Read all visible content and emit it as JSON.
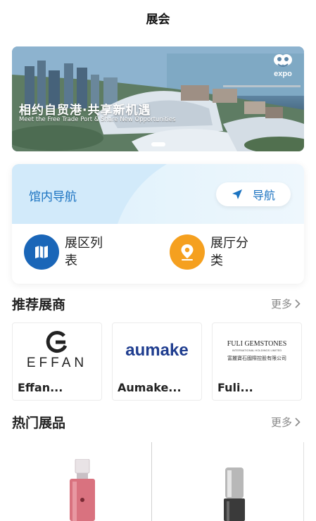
{
  "header": {
    "title": "展会"
  },
  "banner": {
    "headline": "相约自贸港·共享新机遇",
    "subline": "Meet the Free Trade Port & Share New Opportunities",
    "logo_text": "expo"
  },
  "navigation_card": {
    "title": "馆内导航",
    "button_label": "导航",
    "items": [
      {
        "label": "展区列表",
        "icon": "map-icon",
        "color": "#1a66b8"
      },
      {
        "label": "展厅分类",
        "icon": "location-pin-icon",
        "color": "#f5a01f"
      }
    ]
  },
  "recommended_exhibitors": {
    "title": "推荐展商",
    "more_label": "更多",
    "items": [
      {
        "logo_text": "EFFAN",
        "name": "Effan..."
      },
      {
        "logo_text": "aumake",
        "name": "Aumake..."
      },
      {
        "logo_text": "FULI GEMSTONES",
        "logo_sub": "INTERNATIONAL HOLDINGS LIMITED",
        "logo_cn": "富麗寶石國際控股有限公司",
        "name": "Fuli..."
      }
    ]
  },
  "hot_products": {
    "title": "热门展品",
    "more_label": "更多"
  }
}
